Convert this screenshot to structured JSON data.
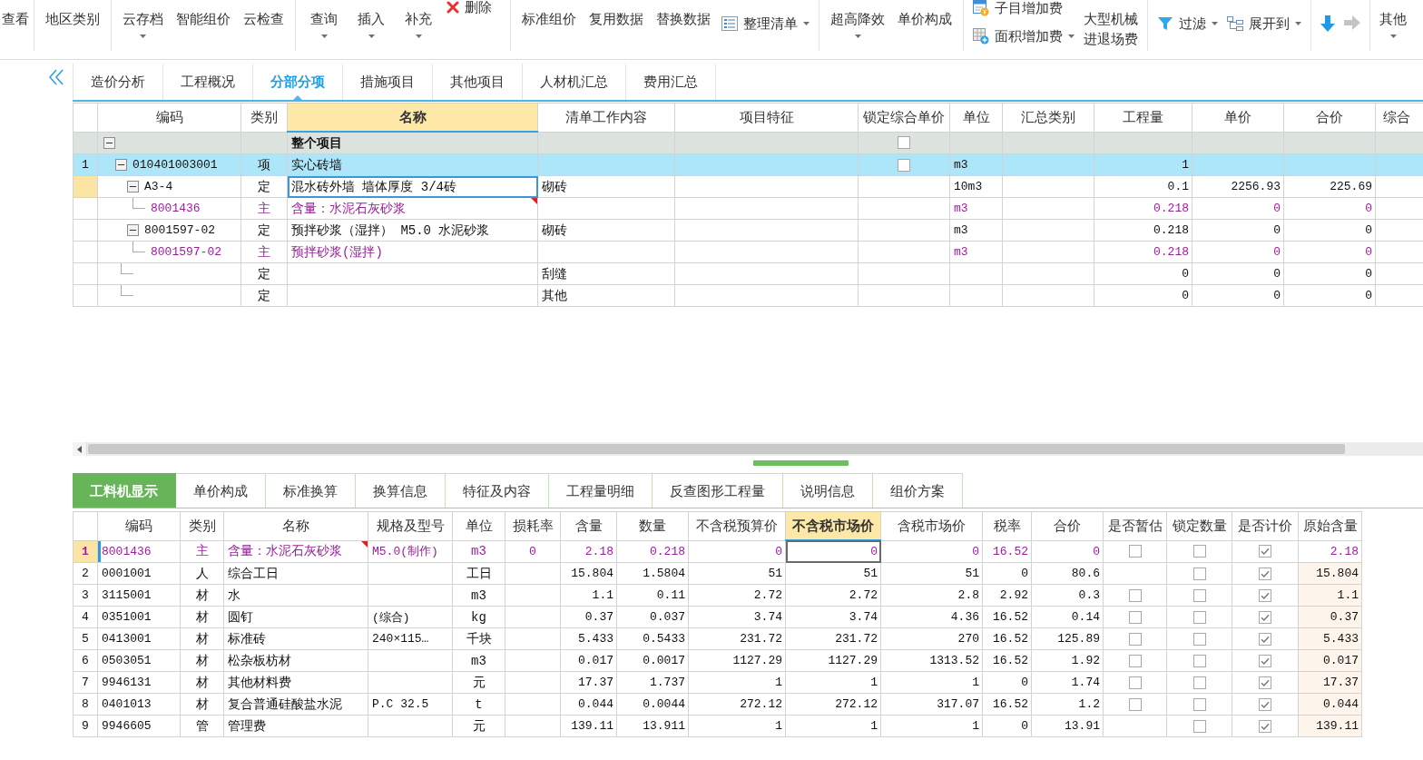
{
  "toolbar": {
    "groups": [
      {
        "items": [
          {
            "kind": "large",
            "label": "查看",
            "dropdown": false
          }
        ]
      },
      {
        "items": [
          {
            "kind": "large",
            "label": "地区类别",
            "dropdown": false
          }
        ]
      },
      {
        "items": [
          {
            "kind": "large",
            "label": "云存档",
            "dropdown": true
          },
          {
            "kind": "large",
            "label": "智能组价",
            "dropdown": false
          },
          {
            "kind": "large",
            "label": "云检查",
            "dropdown": false
          }
        ]
      },
      {
        "items": [
          {
            "kind": "large",
            "label": "查询",
            "dropdown": true
          },
          {
            "kind": "large",
            "label": "插入",
            "dropdown": true
          },
          {
            "kind": "large",
            "label": "补充",
            "dropdown": true
          },
          {
            "kind": "delete",
            "label": "删除",
            "dropdown": false
          }
        ]
      },
      {
        "items": [
          {
            "kind": "large",
            "label": "标准组价",
            "dropdown": false
          },
          {
            "kind": "large",
            "label": "复用数据",
            "dropdown": false
          },
          {
            "kind": "large",
            "label": "替换数据",
            "dropdown": false
          },
          {
            "kind": "organize",
            "label": "整理清单",
            "dropdown": true
          }
        ]
      },
      {
        "items": [
          {
            "kind": "large",
            "label": "超高降效",
            "dropdown": true
          },
          {
            "kind": "large",
            "label": "单价构成",
            "dropdown": false
          }
        ]
      },
      {
        "items": [
          {
            "kind": "stack",
            "entries": [
              {
                "kind": "subitem",
                "label": "子目增加费",
                "dropdown": false
              },
              {
                "kind": "area",
                "label": "面积增加费",
                "dropdown": true
              }
            ]
          },
          {
            "kind": "twoline",
            "lines": [
              "大型机械",
              "进退场费"
            ],
            "dropdown": false
          }
        ]
      },
      {
        "items": [
          {
            "kind": "filter",
            "label": "过滤",
            "dropdown": true
          },
          {
            "kind": "expand",
            "label": "展开到",
            "dropdown": true
          }
        ]
      },
      {
        "items": [
          {
            "kind": "down",
            "disabled": false
          },
          {
            "kind": "right",
            "disabled": true
          }
        ]
      },
      {
        "items": [
          {
            "kind": "large",
            "label": "其他",
            "dropdown": true
          }
        ]
      }
    ]
  },
  "tabs": [
    {
      "label": "造价分析",
      "selected": false
    },
    {
      "label": "工程概况",
      "selected": false
    },
    {
      "label": "分部分项",
      "selected": true
    },
    {
      "label": "措施项目",
      "selected": false
    },
    {
      "label": "其他项目",
      "selected": false
    },
    {
      "label": "人材机汇总",
      "selected": false
    },
    {
      "label": "费用汇总",
      "selected": false
    }
  ],
  "bill_table": {
    "columns": [
      {
        "label": "编码",
        "selected": false
      },
      {
        "label": "类别",
        "selected": false
      },
      {
        "label": "名称",
        "selected": true
      },
      {
        "label": "清单工作内容",
        "selected": false
      },
      {
        "label": "项目特征",
        "selected": false
      },
      {
        "label": "锁定综合单价",
        "selected": false
      },
      {
        "label": "单位",
        "selected": false
      },
      {
        "label": "汇总类别",
        "selected": false
      },
      {
        "label": "工程量",
        "selected": false
      },
      {
        "label": "单价",
        "selected": false
      },
      {
        "label": "合价",
        "selected": false
      },
      {
        "label": "综合",
        "selected": false
      }
    ],
    "rows": [
      {
        "kind": "root",
        "name": "整个项目",
        "locked": false,
        "expanded": true,
        "selected": false,
        "current": false,
        "flagged": false,
        "children": [
          {
            "kind": "item",
            "number": "1",
            "code": "010401003001",
            "type": "项",
            "name": "实心砖墙",
            "locked": false,
            "unit": "m3",
            "quantity": "1",
            "expanded": true,
            "selected": true,
            "current": false,
            "flagged": false,
            "children": [
              {
                "kind": "item",
                "code": "A3-4",
                "type": "定",
                "name": "混水砖外墙 墙体厚度 3/4砖",
                "work": "砌砖",
                "unit": "10m3",
                "quantity": "0.1",
                "price": "2256.93",
                "total": "225.69",
                "expanded": true,
                "selected": false,
                "current": true,
                "flagged": false,
                "children": [
                  {
                    "kind": "material",
                    "code": "8001436",
                    "type": "主",
                    "name": "含量：水泥石灰砂浆",
                    "unit": "m3",
                    "quantity": "0.218",
                    "price": "0",
                    "total": "0",
                    "selected": false,
                    "current": false,
                    "flagged": true
                  }
                ]
              },
              {
                "kind": "item",
                "code": "8001597-02",
                "type": "定",
                "name": "预拌砂浆（湿拌） M5.0 水泥砂浆",
                "work": "砌砖",
                "unit": "m3",
                "quantity": "0.218",
                "price": "0",
                "total": "0",
                "expanded": true,
                "selected": false,
                "current": false,
                "flagged": false,
                "children": [
                  {
                    "kind": "material",
                    "code": "8001597-02",
                    "type": "主",
                    "name": "预拌砂浆(湿拌)",
                    "unit": "m3",
                    "quantity": "0.218",
                    "price": "0",
                    "total": "0",
                    "selected": false,
                    "current": false,
                    "flagged": false
                  }
                ]
              },
              {
                "kind": "item",
                "type": "定",
                "work": "刮缝",
                "quantity": "0",
                "price": "0",
                "total": "0",
                "selected": false,
                "current": false,
                "flagged": false
              },
              {
                "kind": "item",
                "type": "定",
                "work": "其他",
                "quantity": "0",
                "price": "0",
                "total": "0",
                "selected": false,
                "current": false,
                "flagged": false
              }
            ]
          }
        ]
      }
    ]
  },
  "detail_tabs": [
    {
      "label": "工料机显示",
      "selected": true
    },
    {
      "label": "单价构成",
      "selected": false
    },
    {
      "label": "标准换算",
      "selected": false
    },
    {
      "label": "换算信息",
      "selected": false
    },
    {
      "label": "特征及内容",
      "selected": false
    },
    {
      "label": "工程量明细",
      "selected": false
    },
    {
      "label": "反查图形工程量",
      "selected": false
    },
    {
      "label": "说明信息",
      "selected": false
    },
    {
      "label": "组价方案",
      "selected": false
    }
  ],
  "detail_table": {
    "columns": [
      {
        "label": "编码",
        "selected": false
      },
      {
        "label": "类别",
        "selected": false
      },
      {
        "label": "名称",
        "selected": false
      },
      {
        "label": "规格及型号",
        "selected": false
      },
      {
        "label": "单位",
        "selected": false
      },
      {
        "label": "损耗率",
        "selected": false
      },
      {
        "label": "含量",
        "selected": false
      },
      {
        "label": "数量",
        "selected": false
      },
      {
        "label": "不含税预算价",
        "selected": false
      },
      {
        "label": "不含税市场价",
        "selected": true
      },
      {
        "label": "含税市场价",
        "selected": false
      },
      {
        "label": "税率",
        "selected": false
      },
      {
        "label": "合价",
        "selected": false
      },
      {
        "label": "是否暂估",
        "selected": false
      },
      {
        "label": "锁定数量",
        "selected": false
      },
      {
        "label": "是否计价",
        "selected": false
      },
      {
        "label": "原始含量",
        "selected": false
      }
    ],
    "rows": [
      {
        "kind": "main",
        "number": "1",
        "code": "8001436",
        "type": "主",
        "name": "含量：水泥石灰砂浆",
        "spec": "M5.0(制作)",
        "unit": "m3",
        "loss": "0",
        "content": "2.18",
        "quantity": "0.218",
        "budget_price": "0",
        "market_price": "0",
        "market_price_tax": "0",
        "tax_rate": "16.52",
        "total": "0",
        "provisional": false,
        "lock_quantity": false,
        "priced": true,
        "original_content": "2.18",
        "selected": true,
        "flagged": true
      },
      {
        "kind": "resource",
        "number": "2",
        "code": "0001001",
        "type": "人",
        "name": "综合工日",
        "unit": "工日",
        "content": "15.804",
        "quantity": "1.5804",
        "budget_price": "51",
        "market_price": "51",
        "market_price_tax": "51",
        "tax_rate": "0",
        "total": "80.6",
        "lock_quantity": false,
        "priced": true,
        "original_content": "15.804",
        "selected": false,
        "flagged": false
      },
      {
        "kind": "resource",
        "number": "3",
        "code": "3115001",
        "type": "材",
        "name": "水",
        "unit": "m3",
        "content": "1.1",
        "quantity": "0.11",
        "budget_price": "2.72",
        "market_price": "2.72",
        "market_price_tax": "2.8",
        "tax_rate": "2.92",
        "total": "0.3",
        "provisional": false,
        "lock_quantity": false,
        "priced": true,
        "original_content": "1.1",
        "selected": false,
        "flagged": false
      },
      {
        "kind": "resource",
        "number": "4",
        "code": "0351001",
        "type": "材",
        "name": "圆钉",
        "spec": "(综合)",
        "unit": "kg",
        "content": "0.37",
        "quantity": "0.037",
        "budget_price": "3.74",
        "market_price": "3.74",
        "market_price_tax": "4.36",
        "tax_rate": "16.52",
        "total": "0.14",
        "provisional": false,
        "lock_quantity": false,
        "priced": true,
        "original_content": "0.37",
        "selected": false,
        "flagged": false
      },
      {
        "kind": "resource",
        "number": "5",
        "code": "0413001",
        "type": "材",
        "name": "标准砖",
        "spec": "240×115…",
        "unit": "千块",
        "content": "5.433",
        "quantity": "0.5433",
        "budget_price": "231.72",
        "market_price": "231.72",
        "market_price_tax": "270",
        "tax_rate": "16.52",
        "total": "125.89",
        "provisional": false,
        "lock_quantity": false,
        "priced": true,
        "original_content": "5.433",
        "selected": false,
        "flagged": false
      },
      {
        "kind": "resource",
        "number": "6",
        "code": "0503051",
        "type": "材",
        "name": "松杂板枋材",
        "unit": "m3",
        "content": "0.017",
        "quantity": "0.0017",
        "budget_price": "1127.29",
        "market_price": "1127.29",
        "market_price_tax": "1313.52",
        "tax_rate": "16.52",
        "total": "1.92",
        "provisional": false,
        "lock_quantity": false,
        "priced": true,
        "original_content": "0.017",
        "selected": false,
        "flagged": false
      },
      {
        "kind": "resource",
        "number": "7",
        "code": "9946131",
        "type": "材",
        "name": "其他材料费",
        "unit": "元",
        "content": "17.37",
        "quantity": "1.737",
        "budget_price": "1",
        "market_price": "1",
        "market_price_tax": "1",
        "tax_rate": "0",
        "total": "1.74",
        "provisional": false,
        "lock_quantity": false,
        "priced": true,
        "original_content": "17.37",
        "selected": false,
        "flagged": false
      },
      {
        "kind": "resource",
        "number": "8",
        "code": "0401013",
        "type": "材",
        "name": "复合普通硅酸盐水泥",
        "spec": "P.C 32.5",
        "unit": "t",
        "content": "0.044",
        "quantity": "0.0044",
        "budget_price": "272.12",
        "market_price": "272.12",
        "market_price_tax": "317.07",
        "tax_rate": "16.52",
        "total": "1.2",
        "provisional": false,
        "lock_quantity": false,
        "priced": true,
        "original_content": "0.044",
        "selected": false,
        "flagged": false
      },
      {
        "kind": "resource",
        "number": "9",
        "code": "9946605",
        "type": "管",
        "name": "管理费",
        "unit": "元",
        "content": "139.11",
        "quantity": "13.911",
        "budget_price": "1",
        "market_price": "1",
        "market_price_tax": "1",
        "tax_rate": "0",
        "total": "13.91",
        "lock_quantity": false,
        "priced": true,
        "original_content": "139.11",
        "selected": false,
        "flagged": false
      }
    ]
  }
}
